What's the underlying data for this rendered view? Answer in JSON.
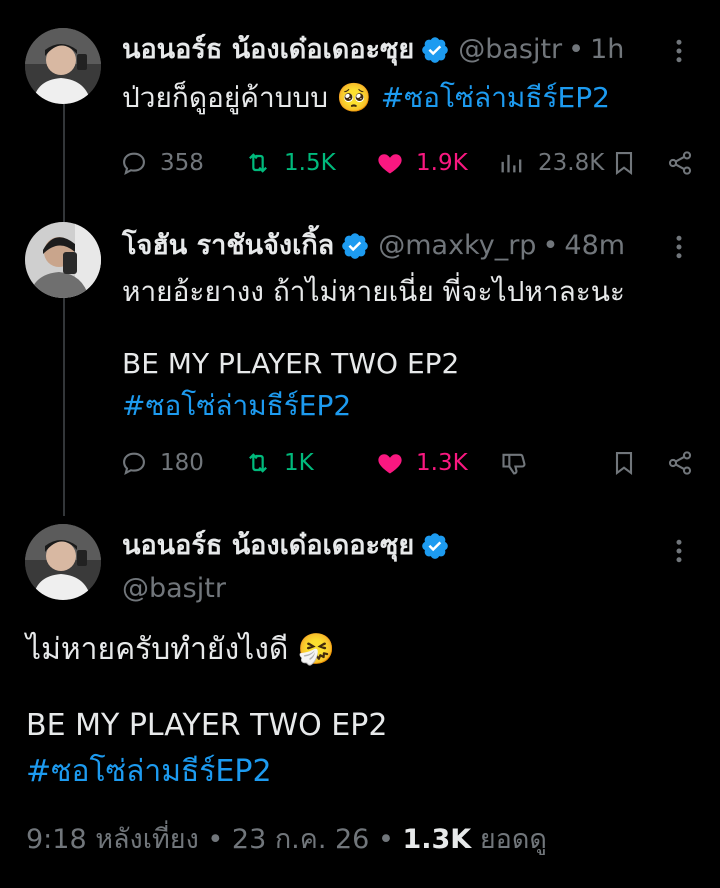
{
  "colors": {
    "accent": "#1d9bf0",
    "muted": "#71767b",
    "retweet": "#00ba7c",
    "like": "#f91880",
    "background": "#000000"
  },
  "tweet1": {
    "display_name": "นอนอร์ธ น้องเด๋อเดอะซุย",
    "handle": "@basjtr",
    "time": "1h",
    "text": "ป่วยก็ดูอยู่ค้าบบบ 🥺",
    "hashtag": "#ซอโซ่ล่ามธีร์EP2",
    "replies": "358",
    "retweets": "1.5K",
    "likes": "1.9K",
    "views": "23.8K",
    "icons": [
      "reply-icon",
      "retweet-icon",
      "heart-icon",
      "views-icon",
      "bookmark-icon",
      "share-icon"
    ]
  },
  "tweet2": {
    "display_name": "โจฮัน ราชันจังเกิ้ล",
    "handle": "@maxky_rp",
    "time": "48m",
    "text_line1": "หายอ้ะยางง ถ้าไม่หายเนี่ย พี่จะไปหาละนะ",
    "text_line2": "BE MY PLAYER TWO EP2",
    "hashtag": "#ซอโซ่ล่ามธีร์EP2",
    "replies": "180",
    "retweets": "1K",
    "likes": "1.3K",
    "icons": [
      "reply-icon",
      "retweet-icon",
      "heart-icon",
      "dislike-icon",
      "bookmark-icon",
      "share-icon"
    ]
  },
  "tweet3": {
    "display_name": "นอนอร์ธ น้องเด๋อเดอะซุย",
    "handle": "@basjtr",
    "text_line1": "ไม่หายครับทำยังไงดี 🤧",
    "text_line2": "BE MY PLAYER TWO EP2",
    "hashtag": "#ซอโซ่ล่ามธีร์EP2",
    "footer": {
      "time": "9:18 หลังเที่ยง",
      "date": "23 ก.ค. 26",
      "views_count": "1.3K",
      "views_label": "ยอดดู"
    }
  }
}
